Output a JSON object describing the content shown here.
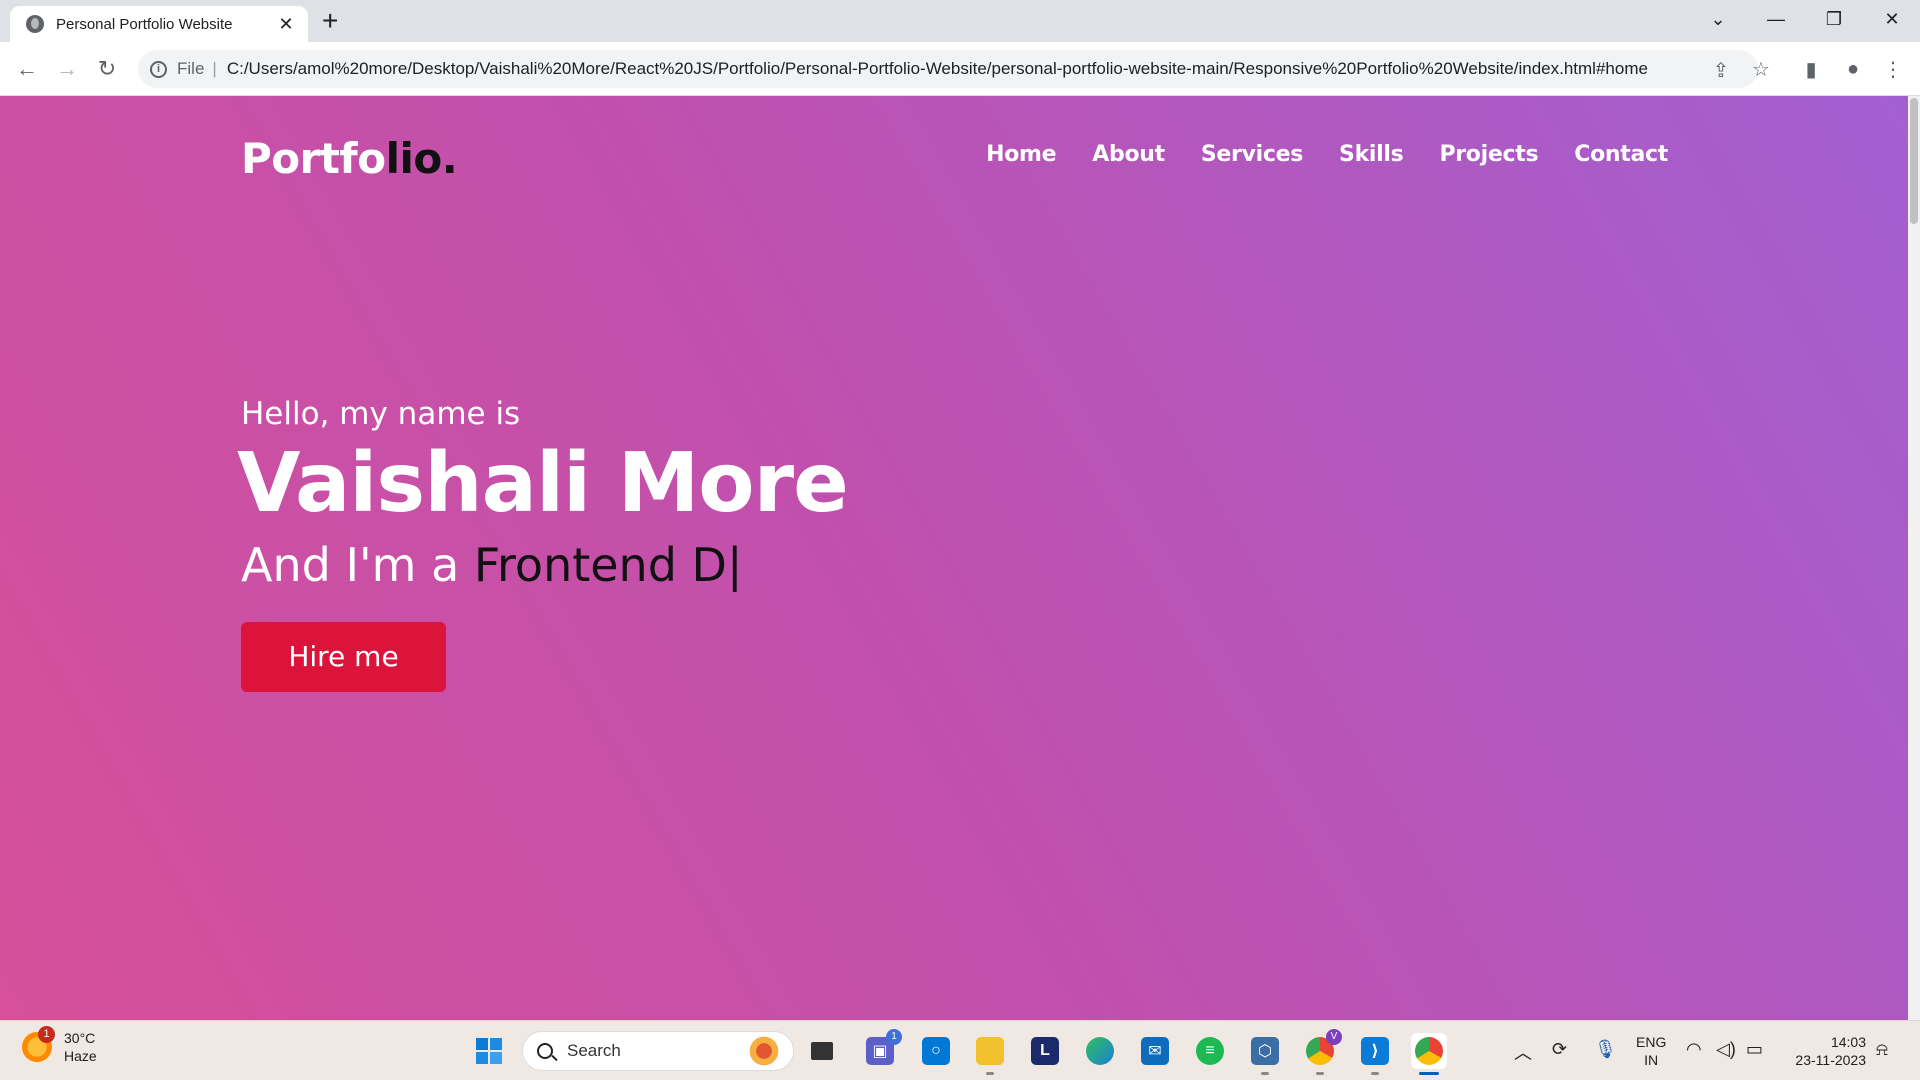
{
  "browser": {
    "tab_title": "Personal Portfolio Website",
    "new_tab_symbol": "+",
    "url_scheme": "File",
    "url": "C:/Users/amol%20more/Desktop/Vaishali%20More/React%20JS/Portfolio/Personal-Portfolio-Website/personal-portfolio-website-main/Responsive%20Portfolio%20Website/index.html#home"
  },
  "site": {
    "logo_part1": "Portfo",
    "logo_part2": "lio.",
    "nav": [
      "Home",
      "About",
      "Services",
      "Skills",
      "Projects",
      "Contact"
    ],
    "hero": {
      "greeting": "Hello, my name is",
      "name": "Vaishali More",
      "role_prefix": "And I'm a ",
      "role_typed": "Frontend D|",
      "cta": "Hire me"
    }
  },
  "taskbar": {
    "weather_temp": "30°C",
    "weather_desc": "Haze",
    "weather_badge": "1",
    "search_label": "Search",
    "teams_badge": "1",
    "lang_line1": "ENG",
    "lang_line2": "IN",
    "time": "14:03",
    "date": "23-11-2023"
  },
  "colors": {
    "hero_gradient_start": "#d6509a",
    "hero_gradient_end": "#a35fd1",
    "cta_bg": "#dc143c"
  }
}
